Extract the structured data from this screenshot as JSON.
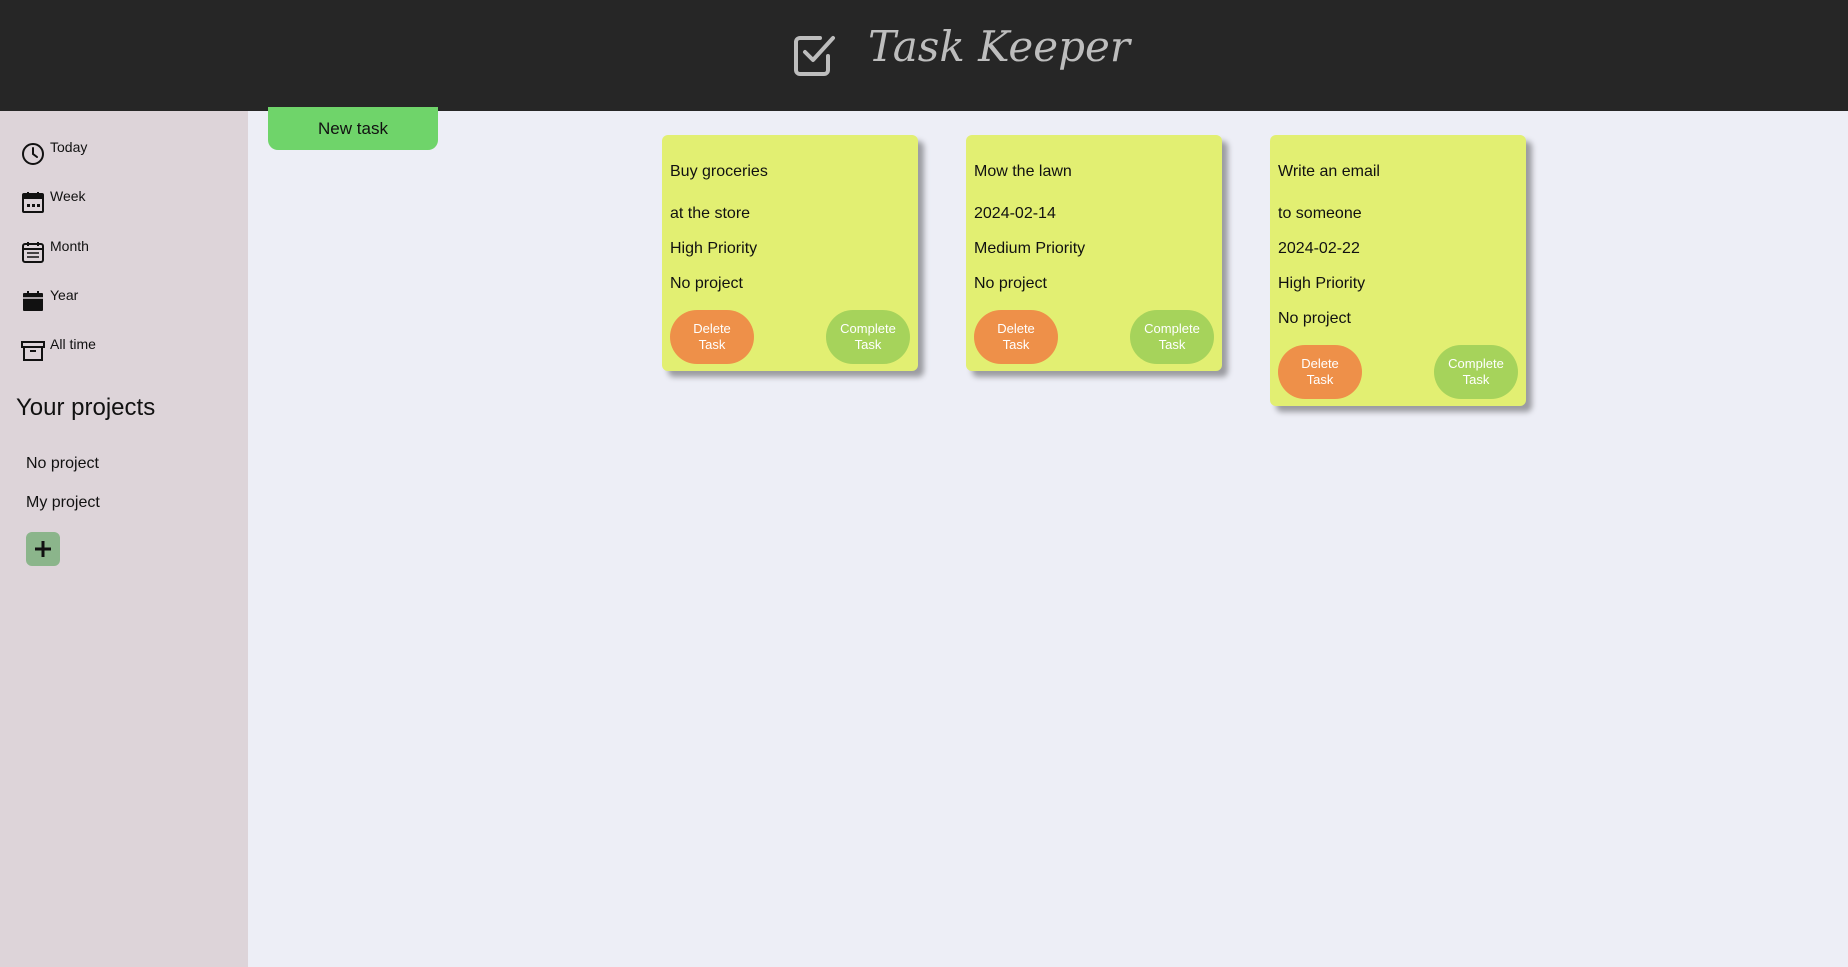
{
  "header": {
    "title": "Task Keeper",
    "logo_icon": "checkbox-icon",
    "background": "#262626"
  },
  "sidebar": {
    "nav": [
      {
        "label": "Today",
        "icon": "clock-icon"
      },
      {
        "label": "Week",
        "icon": "calendar-week-icon"
      },
      {
        "label": "Month",
        "icon": "calendar-month-icon"
      },
      {
        "label": "Year",
        "icon": "calendar-year-icon"
      },
      {
        "label": "All time",
        "icon": "archive-icon"
      }
    ],
    "projects_title": "Your projects",
    "projects": [
      {
        "label": "No project"
      },
      {
        "label": "My project"
      }
    ],
    "add_project_icon": "plus-icon"
  },
  "main": {
    "new_task_label": "New task",
    "tasks": [
      {
        "title": "Buy groceries",
        "lines": [
          "at the store",
          "High Priority",
          "No project"
        ],
        "delete_label": "Delete Task",
        "complete_label": "Complete Task"
      },
      {
        "title": "Mow the lawn",
        "lines": [
          "2024-02-14",
          "Medium Priority",
          "No project"
        ],
        "delete_label": "Delete Task",
        "complete_label": "Complete Task"
      },
      {
        "title": "Write an email",
        "lines": [
          "to someone",
          "2024-02-22",
          "High Priority",
          "No project"
        ],
        "delete_label": "Delete Task",
        "complete_label": "Complete Task"
      }
    ]
  },
  "colors": {
    "card": "#e2ef72",
    "delete": "#ee9049",
    "complete": "#a6d35b",
    "new_task": "#6fd46a",
    "sidebar": "#ddd4d9",
    "main_bg": "#edeef6"
  }
}
